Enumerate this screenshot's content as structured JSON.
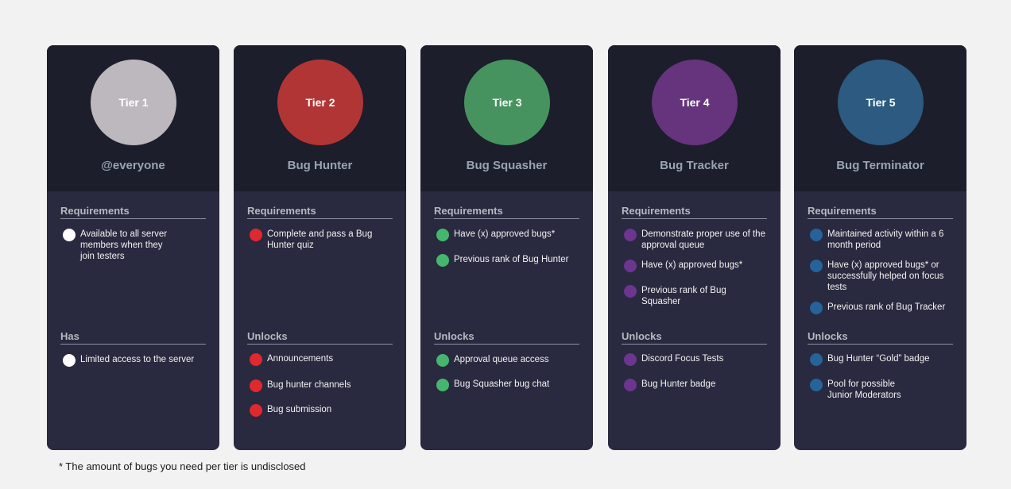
{
  "tiers": [
    {
      "tier_label": "Tier 1",
      "rank_name": "@everyone",
      "circle_color": "#bdb8bd",
      "dot_color": "#ffffff",
      "req_title": "Requirements",
      "requirements": [
        "Available to all server members when they join testers"
      ],
      "unlock_title": "Has",
      "unlocks": [
        "Limited access to the server"
      ]
    },
    {
      "tier_label": "Tier 2",
      "rank_name": "Bug Hunter",
      "circle_color": "#b23535",
      "dot_color": "#e0282f",
      "req_title": "Requirements",
      "requirements": [
        "Complete and pass a Bug Hunter quiz"
      ],
      "unlock_title": "Unlocks",
      "unlocks": [
        "Announcements",
        "Bug hunter channels",
        "Bug submission"
      ]
    },
    {
      "tier_label": "Tier 3",
      "rank_name": "Bug Squasher",
      "circle_color": "#46935f",
      "dot_color": "#45b66d",
      "req_title": "Requirements",
      "requirements": [
        "Have (x) approved bugs*",
        "Previous rank of Bug Hunter"
      ],
      "unlock_title": "Unlocks",
      "unlocks": [
        "Approval queue access",
        "Bug Squasher bug chat"
      ]
    },
    {
      "tier_label": "Tier 4",
      "rank_name": "Bug Tracker",
      "circle_color": "#65347c",
      "dot_color": "#6b3590",
      "req_title": "Requirements",
      "requirements": [
        "Demonstrate proper use of the approval queue",
        "Have (x) approved bugs*",
        "Previous rank of Bug Squasher"
      ],
      "unlock_title": "Unlocks",
      "unlocks": [
        "Discord Focus Tests",
        "Bug Hunter badge"
      ]
    },
    {
      "tier_label": "Tier 5",
      "rank_name": "Bug Terminator",
      "circle_color": "#2c5a80",
      "dot_color": "#25639a",
      "req_title": "Requirements",
      "requirements": [
        "Maintained activity within a 6 month period",
        "Have (x) approved bugs* or successfully helped on focus tests",
        "Previous rank of Bug Tracker"
      ],
      "unlock_title": "Unlocks",
      "unlocks": [
        "Bug Hunter “Gold” badge",
        "Pool for possible Junior Moderators"
      ]
    }
  ],
  "footnote": "* The amount of bugs you need per tier is undisclosed"
}
